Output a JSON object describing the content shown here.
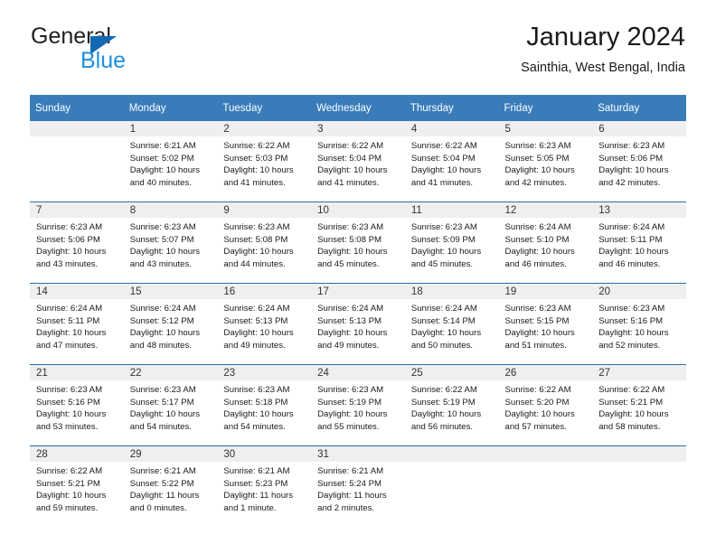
{
  "brand": {
    "name_top": "General",
    "name_bottom": "Blue",
    "triangle_color": "#1268b3",
    "blue_color": "#1f8fe0"
  },
  "header": {
    "title": "January 2024",
    "location": "Sainthia, West Bengal, India"
  },
  "theme": {
    "header_blue": "#3a7cba",
    "row_divider_blue": "#2e6da4",
    "daynum_band": "#efefef"
  },
  "weekday_headers": [
    "Sunday",
    "Monday",
    "Tuesday",
    "Wednesday",
    "Thursday",
    "Friday",
    "Saturday"
  ],
  "weeks": [
    [
      {
        "day": "",
        "lines": []
      },
      {
        "day": "1",
        "lines": [
          "Sunrise: 6:21 AM",
          "Sunset: 5:02 PM",
          "Daylight: 10 hours",
          "and 40 minutes."
        ]
      },
      {
        "day": "2",
        "lines": [
          "Sunrise: 6:22 AM",
          "Sunset: 5:03 PM",
          "Daylight: 10 hours",
          "and 41 minutes."
        ]
      },
      {
        "day": "3",
        "lines": [
          "Sunrise: 6:22 AM",
          "Sunset: 5:04 PM",
          "Daylight: 10 hours",
          "and 41 minutes."
        ]
      },
      {
        "day": "4",
        "lines": [
          "Sunrise: 6:22 AM",
          "Sunset: 5:04 PM",
          "Daylight: 10 hours",
          "and 41 minutes."
        ]
      },
      {
        "day": "5",
        "lines": [
          "Sunrise: 6:23 AM",
          "Sunset: 5:05 PM",
          "Daylight: 10 hours",
          "and 42 minutes."
        ]
      },
      {
        "day": "6",
        "lines": [
          "Sunrise: 6:23 AM",
          "Sunset: 5:06 PM",
          "Daylight: 10 hours",
          "and 42 minutes."
        ]
      }
    ],
    [
      {
        "day": "7",
        "lines": [
          "Sunrise: 6:23 AM",
          "Sunset: 5:06 PM",
          "Daylight: 10 hours",
          "and 43 minutes."
        ]
      },
      {
        "day": "8",
        "lines": [
          "Sunrise: 6:23 AM",
          "Sunset: 5:07 PM",
          "Daylight: 10 hours",
          "and 43 minutes."
        ]
      },
      {
        "day": "9",
        "lines": [
          "Sunrise: 6:23 AM",
          "Sunset: 5:08 PM",
          "Daylight: 10 hours",
          "and 44 minutes."
        ]
      },
      {
        "day": "10",
        "lines": [
          "Sunrise: 6:23 AM",
          "Sunset: 5:08 PM",
          "Daylight: 10 hours",
          "and 45 minutes."
        ]
      },
      {
        "day": "11",
        "lines": [
          "Sunrise: 6:23 AM",
          "Sunset: 5:09 PM",
          "Daylight: 10 hours",
          "and 45 minutes."
        ]
      },
      {
        "day": "12",
        "lines": [
          "Sunrise: 6:24 AM",
          "Sunset: 5:10 PM",
          "Daylight: 10 hours",
          "and 46 minutes."
        ]
      },
      {
        "day": "13",
        "lines": [
          "Sunrise: 6:24 AM",
          "Sunset: 5:11 PM",
          "Daylight: 10 hours",
          "and 46 minutes."
        ]
      }
    ],
    [
      {
        "day": "14",
        "lines": [
          "Sunrise: 6:24 AM",
          "Sunset: 5:11 PM",
          "Daylight: 10 hours",
          "and 47 minutes."
        ]
      },
      {
        "day": "15",
        "lines": [
          "Sunrise: 6:24 AM",
          "Sunset: 5:12 PM",
          "Daylight: 10 hours",
          "and 48 minutes."
        ]
      },
      {
        "day": "16",
        "lines": [
          "Sunrise: 6:24 AM",
          "Sunset: 5:13 PM",
          "Daylight: 10 hours",
          "and 49 minutes."
        ]
      },
      {
        "day": "17",
        "lines": [
          "Sunrise: 6:24 AM",
          "Sunset: 5:13 PM",
          "Daylight: 10 hours",
          "and 49 minutes."
        ]
      },
      {
        "day": "18",
        "lines": [
          "Sunrise: 6:24 AM",
          "Sunset: 5:14 PM",
          "Daylight: 10 hours",
          "and 50 minutes."
        ]
      },
      {
        "day": "19",
        "lines": [
          "Sunrise: 6:23 AM",
          "Sunset: 5:15 PM",
          "Daylight: 10 hours",
          "and 51 minutes."
        ]
      },
      {
        "day": "20",
        "lines": [
          "Sunrise: 6:23 AM",
          "Sunset: 5:16 PM",
          "Daylight: 10 hours",
          "and 52 minutes."
        ]
      }
    ],
    [
      {
        "day": "21",
        "lines": [
          "Sunrise: 6:23 AM",
          "Sunset: 5:16 PM",
          "Daylight: 10 hours",
          "and 53 minutes."
        ]
      },
      {
        "day": "22",
        "lines": [
          "Sunrise: 6:23 AM",
          "Sunset: 5:17 PM",
          "Daylight: 10 hours",
          "and 54 minutes."
        ]
      },
      {
        "day": "23",
        "lines": [
          "Sunrise: 6:23 AM",
          "Sunset: 5:18 PM",
          "Daylight: 10 hours",
          "and 54 minutes."
        ]
      },
      {
        "day": "24",
        "lines": [
          "Sunrise: 6:23 AM",
          "Sunset: 5:19 PM",
          "Daylight: 10 hours",
          "and 55 minutes."
        ]
      },
      {
        "day": "25",
        "lines": [
          "Sunrise: 6:22 AM",
          "Sunset: 5:19 PM",
          "Daylight: 10 hours",
          "and 56 minutes."
        ]
      },
      {
        "day": "26",
        "lines": [
          "Sunrise: 6:22 AM",
          "Sunset: 5:20 PM",
          "Daylight: 10 hours",
          "and 57 minutes."
        ]
      },
      {
        "day": "27",
        "lines": [
          "Sunrise: 6:22 AM",
          "Sunset: 5:21 PM",
          "Daylight: 10 hours",
          "and 58 minutes."
        ]
      }
    ],
    [
      {
        "day": "28",
        "lines": [
          "Sunrise: 6:22 AM",
          "Sunset: 5:21 PM",
          "Daylight: 10 hours",
          "and 59 minutes."
        ]
      },
      {
        "day": "29",
        "lines": [
          "Sunrise: 6:21 AM",
          "Sunset: 5:22 PM",
          "Daylight: 11 hours",
          "and 0 minutes."
        ]
      },
      {
        "day": "30",
        "lines": [
          "Sunrise: 6:21 AM",
          "Sunset: 5:23 PM",
          "Daylight: 11 hours",
          "and 1 minute."
        ]
      },
      {
        "day": "31",
        "lines": [
          "Sunrise: 6:21 AM",
          "Sunset: 5:24 PM",
          "Daylight: 11 hours",
          "and 2 minutes."
        ]
      },
      {
        "day": "",
        "lines": []
      },
      {
        "day": "",
        "lines": []
      },
      {
        "day": "",
        "lines": []
      }
    ]
  ]
}
